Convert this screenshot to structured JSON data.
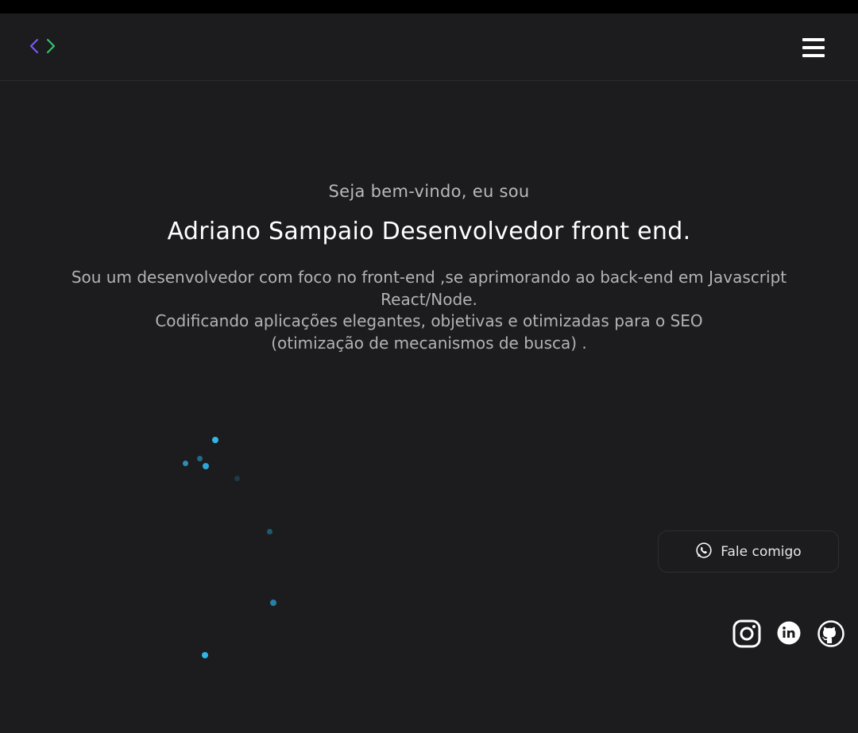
{
  "header": {
    "logo_icon": "code-brackets-icon",
    "menu_icon": "hamburger-menu-icon"
  },
  "hero": {
    "greeting": "Seja bem-vindo, eu sou",
    "title": "Adriano Sampaio Desenvolvedor front end.",
    "description_lines": [
      "Sou um desenvolvedor com foco no front-end ,se aprimorando ao back-end em Javascript",
      "React/Node.",
      "Codificando aplicações elegantes, objetivas e otimizadas para o SEO",
      "(otimização de mecanismos de busca) ."
    ]
  },
  "cta": {
    "icon": "whatsapp-icon",
    "label": "Fale comigo"
  },
  "social": [
    {
      "icon": "instagram-icon"
    },
    {
      "icon": "linkedin-icon"
    },
    {
      "icon": "github-icon"
    }
  ],
  "colors": {
    "background": "#1c1c1e",
    "logo_left": "#7c5cff",
    "logo_right": "#2ecc71",
    "particle": "#2fb6e8",
    "whatsapp": "#25d366"
  }
}
